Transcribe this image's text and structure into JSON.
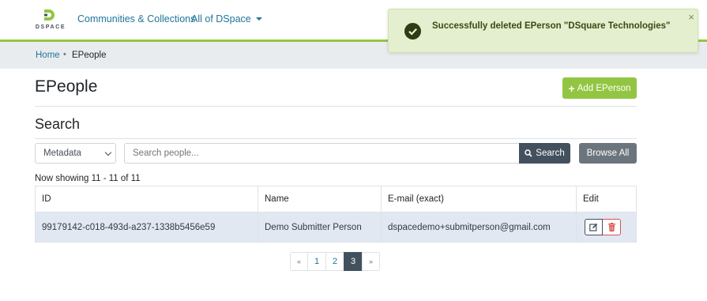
{
  "brand": {
    "logo_text": "DSPACE",
    "accent": "#92c642"
  },
  "nav": {
    "communities_label": "Communities & Collections",
    "all_label": "All of DSpace"
  },
  "breadcrumb": {
    "home": "Home",
    "separator": "•",
    "current": "EPeople"
  },
  "page": {
    "title": "EPeople",
    "add_button": "Add EPerson"
  },
  "search": {
    "heading": "Search",
    "scope_selected": "Metadata",
    "placeholder": "Search people...",
    "search_button": "Search",
    "browse_button": "Browse All"
  },
  "results": {
    "showing_text": "Now showing 11 - 11 of 11",
    "columns": [
      "ID",
      "Name",
      "E-mail (exact)",
      "Edit"
    ],
    "rows": [
      {
        "id": "99179142-c018-493d-a237-1338b5456e59",
        "name": "Demo Submitter Person",
        "email": "dspacedemo+submitperson@gmail.com"
      }
    ]
  },
  "pagination": {
    "prev": "«",
    "pages": [
      "1",
      "2",
      "3"
    ],
    "active": "3",
    "next": "»"
  },
  "toast": {
    "message": "Successfully deleted EPerson \"DSquare Technologies\"",
    "close": "×",
    "icon": "check-circle-icon"
  }
}
